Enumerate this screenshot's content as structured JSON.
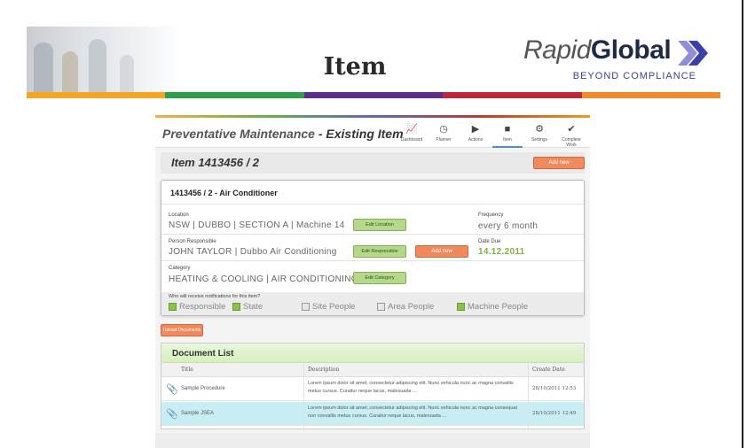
{
  "slide": {
    "title": "Item",
    "brand_light": "Rapid",
    "brand_bold": "Global",
    "brand_tagline": "BEYOND COMPLIANCE",
    "bar_colors": [
      "#f5a623",
      "#2e9e48",
      "#5b2d8e",
      "#c0263b",
      "#f28c28"
    ]
  },
  "app": {
    "title_main": "Preventative Maintenance",
    "title_sub": " - Existing Item",
    "nav": [
      {
        "label": "Dashboard",
        "icon": "chart-icon"
      },
      {
        "label": "Planner",
        "icon": "clock-icon"
      },
      {
        "label": "Actions",
        "icon": "play-icon"
      },
      {
        "label": "Item",
        "icon": "stop-icon"
      },
      {
        "label": "Settings",
        "icon": "gear-icon"
      },
      {
        "label": "Complete Work",
        "icon": "check-icon"
      }
    ],
    "item_heading": "Item 1413456 / 2",
    "add_new_label": "Add new"
  },
  "card": {
    "title": "1413456 / 2   - Air Conditioner",
    "location_label": "Location",
    "location_value": "NSW  |  DUBBO  |  SECTION A  |  Machine 14",
    "edit_location": "Edit Location",
    "frequency_label": "Frequency",
    "frequency_value": "every 6 month",
    "person_label": "Person Responsible",
    "person_value": "JOHN TAYLOR  |  Dubbo Air Conditioning",
    "edit_responsible": "Edit Responsible",
    "add_new": "Add new",
    "due_label": "Date Due",
    "due_value": "14.12.2011",
    "category_label": "Category",
    "category_value": "HEATING & COOLING  |  AIR CONDITIONING",
    "edit_category": "Edit Category",
    "notify_question": "Who will receive notifications for this item?",
    "notify_options": [
      {
        "label": "Responsible",
        "checked": true
      },
      {
        "label": "State",
        "checked": true
      },
      {
        "label": "Site People",
        "checked": false
      },
      {
        "label": "Area People",
        "checked": false
      },
      {
        "label": "Machine People",
        "checked": true
      }
    ]
  },
  "documents": {
    "upload_label": "Upload Documents",
    "heading": "Document List",
    "columns": [
      "Title",
      "Description",
      "Create Date"
    ],
    "rows": [
      {
        "title": "Sample Procedure",
        "description": "Lorem ipsum dolor sit amet, consectetur adipiscing elit. Nunc vehicula nunc ac magna convallis metus cursus. Curaitur neque lacus, malesuada ...",
        "date": "28/10/2011 12:53"
      },
      {
        "title": "Sample JSEA",
        "description": "Lorem ipsum dolor sit amet, consectetur adipiscing elit. Nunc vehicula nunc ac magna consequat non convallis metus cursus. Curaitur neque lacus, malesuada ...",
        "date": "28/10/2011 12:49"
      }
    ]
  }
}
